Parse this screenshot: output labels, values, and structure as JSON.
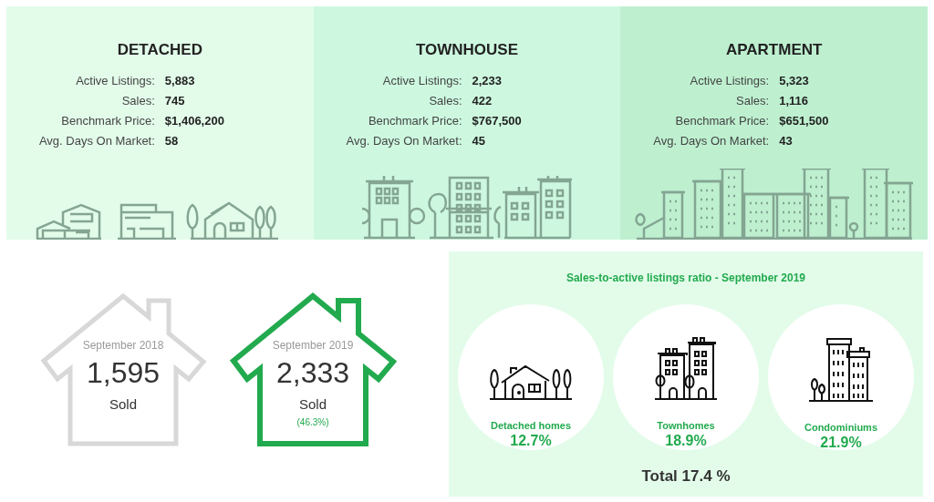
{
  "panels": [
    {
      "kind": "detached",
      "title": "DETACHED",
      "color": "#e3fcea",
      "stats": [
        {
          "label": "Active Listings:",
          "value": "5,883"
        },
        {
          "label": "Sales:",
          "value": "745"
        },
        {
          "label": "Benchmark Price:",
          "value": "$1,406,200"
        },
        {
          "label": "Avg. Days On Market:",
          "value": "58"
        }
      ]
    },
    {
      "kind": "townhouse",
      "title": "TOWNHOUSE",
      "color": "#cdf8df",
      "stats": [
        {
          "label": "Active Listings:",
          "value": "2,233"
        },
        {
          "label": "Sales:",
          "value": "422"
        },
        {
          "label": "Benchmark Price:",
          "value": "$767,500"
        },
        {
          "label": "Avg. Days On Market:",
          "value": "45"
        }
      ]
    },
    {
      "kind": "apartment",
      "title": "APARTMENT",
      "color": "#bef0d0",
      "stats": [
        {
          "label": "Active Listings:",
          "value": "5,323"
        },
        {
          "label": "Sales:",
          "value": "1,116"
        },
        {
          "label": "Benchmark Price:",
          "value": "$651,500"
        },
        {
          "label": "Avg. Days On Market:",
          "value": "43"
        }
      ]
    }
  ],
  "houses": [
    {
      "period": "September 2018",
      "number": "1,595",
      "label": "Sold",
      "highlighted": false
    },
    {
      "period": "September 2019",
      "number": "2,333",
      "label": "Sold",
      "change": "(46.3%)",
      "highlighted": true
    }
  ],
  "ratio": {
    "title": "Sales-to-active listings ratio - September 2019",
    "items": [
      {
        "kind": "detached",
        "label": "Detached homes",
        "value": "12.7%"
      },
      {
        "kind": "townhouse",
        "label": "Townhomes",
        "value": "18.9%"
      },
      {
        "kind": "condo",
        "label": "Condominiums",
        "value": "21.9%"
      }
    ],
    "total": "Total 17.4 %"
  }
}
